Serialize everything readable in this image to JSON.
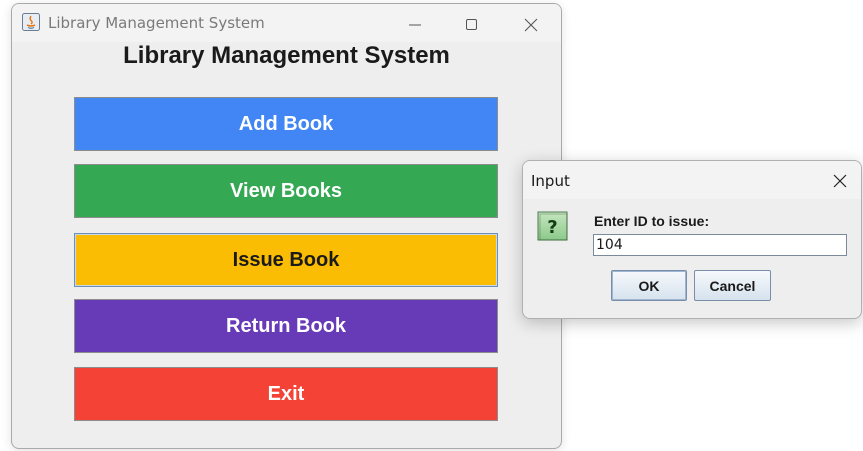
{
  "window": {
    "title": "Library Management System",
    "heading": "Library Management System"
  },
  "menu": [
    {
      "label": "Add Book",
      "color": "#4285f4"
    },
    {
      "label": "View Books",
      "color": "#34a853"
    },
    {
      "label": "Issue Book",
      "color": "#fbbc04"
    },
    {
      "label": "Return Book",
      "color": "#673ab7"
    },
    {
      "label": "Exit",
      "color": "#f44336"
    }
  ],
  "dialog": {
    "title": "Input",
    "prompt": "Enter ID to issue:",
    "input_value": "104",
    "ok_label": "OK",
    "cancel_label": "Cancel",
    "icon": "question-icon"
  }
}
